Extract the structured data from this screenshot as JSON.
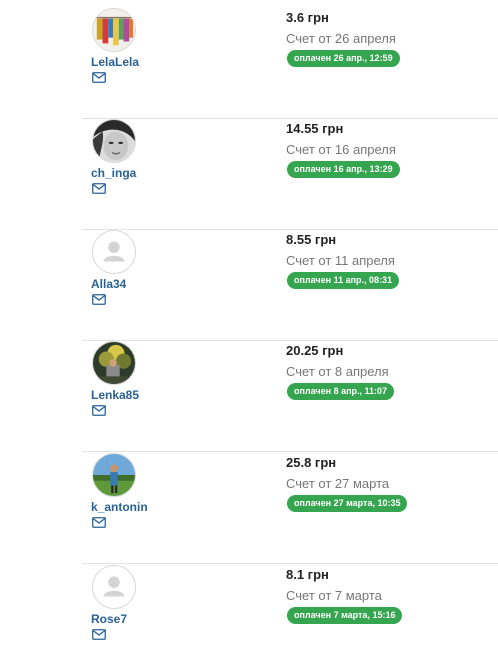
{
  "colors": {
    "badge_bg": "#35a64f",
    "username": "#2a6296",
    "divider": "#e3e3e3"
  },
  "payments": [
    {
      "username": "LelaLela",
      "amount": "3.6 грн",
      "invoice": "Счет от 26 апреля",
      "status": "оплачен 26 апр., 12:59",
      "avatar": "photo-clothes",
      "mail_icon": "envelope-icon"
    },
    {
      "username": "ch_inga",
      "amount": "14.55 грн",
      "invoice": "Счет от 16 апреля",
      "status": "оплачен 16 апр., 13:29",
      "avatar": "photo-face-bw",
      "mail_icon": "envelope-icon"
    },
    {
      "username": "Alla34",
      "amount": "8.55 грн",
      "invoice": "Счет от 11 апреля",
      "status": "оплачен 11 апр., 08:31",
      "avatar": "default-user-icon",
      "mail_icon": "envelope-icon"
    },
    {
      "username": "Lenka85",
      "amount": "20.25 грн",
      "invoice": "Счет от 8 апреля",
      "status": "оплачен 8 апр., 11:07",
      "avatar": "photo-tree",
      "mail_icon": "envelope-icon"
    },
    {
      "username": "k_antonin",
      "amount": "25.8 грн",
      "invoice": "Счет от 27 марта",
      "status": "оплачен 27 марта, 10:35",
      "avatar": "photo-person-field",
      "mail_icon": "envelope-icon"
    },
    {
      "username": "Rose7",
      "amount": "8.1 грн",
      "invoice": "Счет от 7 марта",
      "status": "оплачен 7 марта, 15:16",
      "avatar": "default-user-icon",
      "mail_icon": "envelope-icon"
    }
  ]
}
